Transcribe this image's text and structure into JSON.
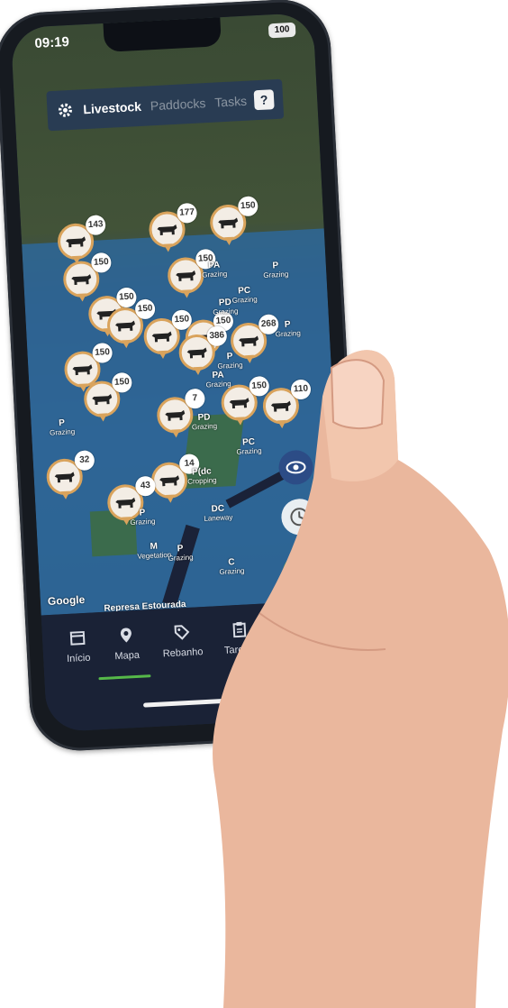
{
  "status_bar": {
    "time": "09:19",
    "battery": "100"
  },
  "top_tabs": {
    "settings_icon": "gear-icon",
    "items": [
      "Livestock",
      "Paddocks",
      "Tasks"
    ],
    "help_label": "?"
  },
  "map": {
    "attribution": "Google",
    "road_label": "Represa Estourada",
    "paddock_labels": [
      {
        "code": "PA",
        "use": "Grazing"
      },
      {
        "code": "P",
        "use": "Grazing"
      },
      {
        "code": "PC",
        "use": "Grazing"
      },
      {
        "code": "PD",
        "use": "Grazing"
      },
      {
        "code": "P",
        "use": "Grazing"
      },
      {
        "code": "P",
        "use": "Grazing"
      },
      {
        "code": "PD",
        "use": "Grazing"
      },
      {
        "code": "PC",
        "use": "Grazing"
      },
      {
        "code": "P(dc",
        "use": "Cropping"
      },
      {
        "code": "DC",
        "use": "Laneway"
      },
      {
        "code": "P",
        "use": "Grazing"
      },
      {
        "code": "M",
        "use": "Vegetation"
      },
      {
        "code": "P",
        "use": "Grazing"
      },
      {
        "code": "C",
        "use": "Grazing"
      },
      {
        "code": "P",
        "use": "Grazing"
      },
      {
        "code": "PA",
        "use": "Grazing"
      }
    ],
    "herd_counts": [
      "143",
      "177",
      "150",
      "150",
      "150",
      "150",
      "150",
      "150",
      "150",
      "386",
      "268",
      "150",
      "150",
      "7",
      "150",
      "110",
      "32",
      "14",
      "43"
    ]
  },
  "fabs": {
    "add_label": "+"
  },
  "bottom_nav": {
    "items": [
      "Início",
      "Mapa",
      "Rebanho",
      "Tarefas"
    ],
    "active": "Mapa"
  }
}
